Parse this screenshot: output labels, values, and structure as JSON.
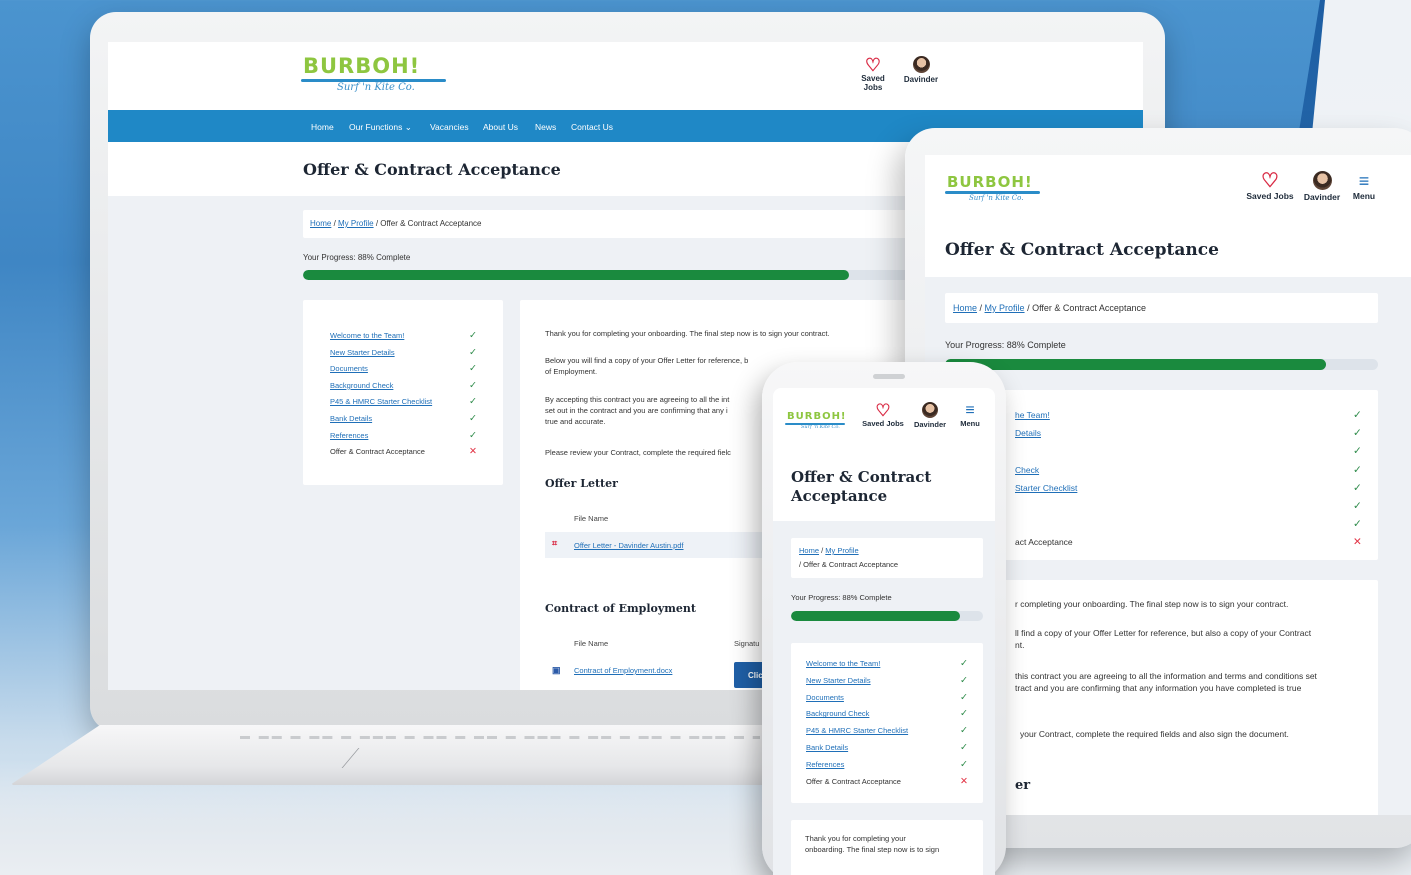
{
  "site": {
    "logo_word": "BURBOH!",
    "logo_tagline": "Surf 'n Kite Co.",
    "saved_jobs": "Saved Jobs",
    "user_name": "Davinder",
    "menu": "Menu"
  },
  "nav": {
    "items": [
      "Home",
      "Our Functions ⌄",
      "Vacancies",
      "About Us",
      "News",
      "Contact Us"
    ]
  },
  "page": {
    "title": "Offer & Contract Acceptance",
    "title_line1": "Offer & Contract",
    "title_line2": "Acceptance",
    "breadcrumb_home": "Home",
    "breadcrumb_profile": "My Profile",
    "breadcrumb_current": "/ Offer & Contract Acceptance",
    "progress_label": "Your Progress: 88% Complete",
    "progress_fraction": 0.88
  },
  "steps": [
    {
      "label": "Welcome to the Team!",
      "status": "done"
    },
    {
      "label": "New Starter Details",
      "status": "done"
    },
    {
      "label": "Documents",
      "status": "done"
    },
    {
      "label": "Background Check",
      "status": "done"
    },
    {
      "label": "P45 & HMRC Starter Checklist",
      "status": "done"
    },
    {
      "label": "Bank Details",
      "status": "done"
    },
    {
      "label": "References",
      "status": "done"
    },
    {
      "label": "Offer & Contract Acceptance",
      "status": "pending"
    }
  ],
  "marks": {
    "done": "✓",
    "pending": "✕"
  },
  "content": {
    "p1": "Thank you for completing your onboarding. The final step now is to sign your contract.",
    "p2a": "Below you will find a copy of your Offer Letter for reference, b",
    "p2b": "of Employment.",
    "p3a": "By accepting this contract you are agreeing to all the int",
    "p3b": "set out in the contract and you are confirming that any i",
    "p3c": "true and accurate.",
    "p4": "Please review your Contract, complete the required fielc",
    "offer_title": "Offer Letter",
    "file_name_col": "File Name",
    "offer_file": "Offer Letter - Davinder Austin.pdf",
    "contract_title": "Contract of Employment",
    "signature_col": "Signatu",
    "contract_file": "Contract of Employment.docx",
    "click_btn": "Clic"
  },
  "tablet": {
    "steps_partial": [
      "he Team!",
      "Details",
      "",
      "Check",
      "Starter Checklist",
      "",
      "",
      "act Acceptance"
    ],
    "p1": "r completing your onboarding. The final step now is to sign your contract.",
    "p2a": "ll find a copy of your Offer Letter for reference, but also a copy of your Contract",
    "p2b": "nt.",
    "p3a": "this contract you are agreeing to all the information and terms and conditions set",
    "p3b": "tract and you are confirming that any information you have completed is true",
    "p4": "your Contract, complete the required fields and also sign the document.",
    "sec": "er"
  },
  "phone": {
    "p1a": "Thank you for completing your",
    "p1b": "onboarding. The final step now is to sign"
  }
}
